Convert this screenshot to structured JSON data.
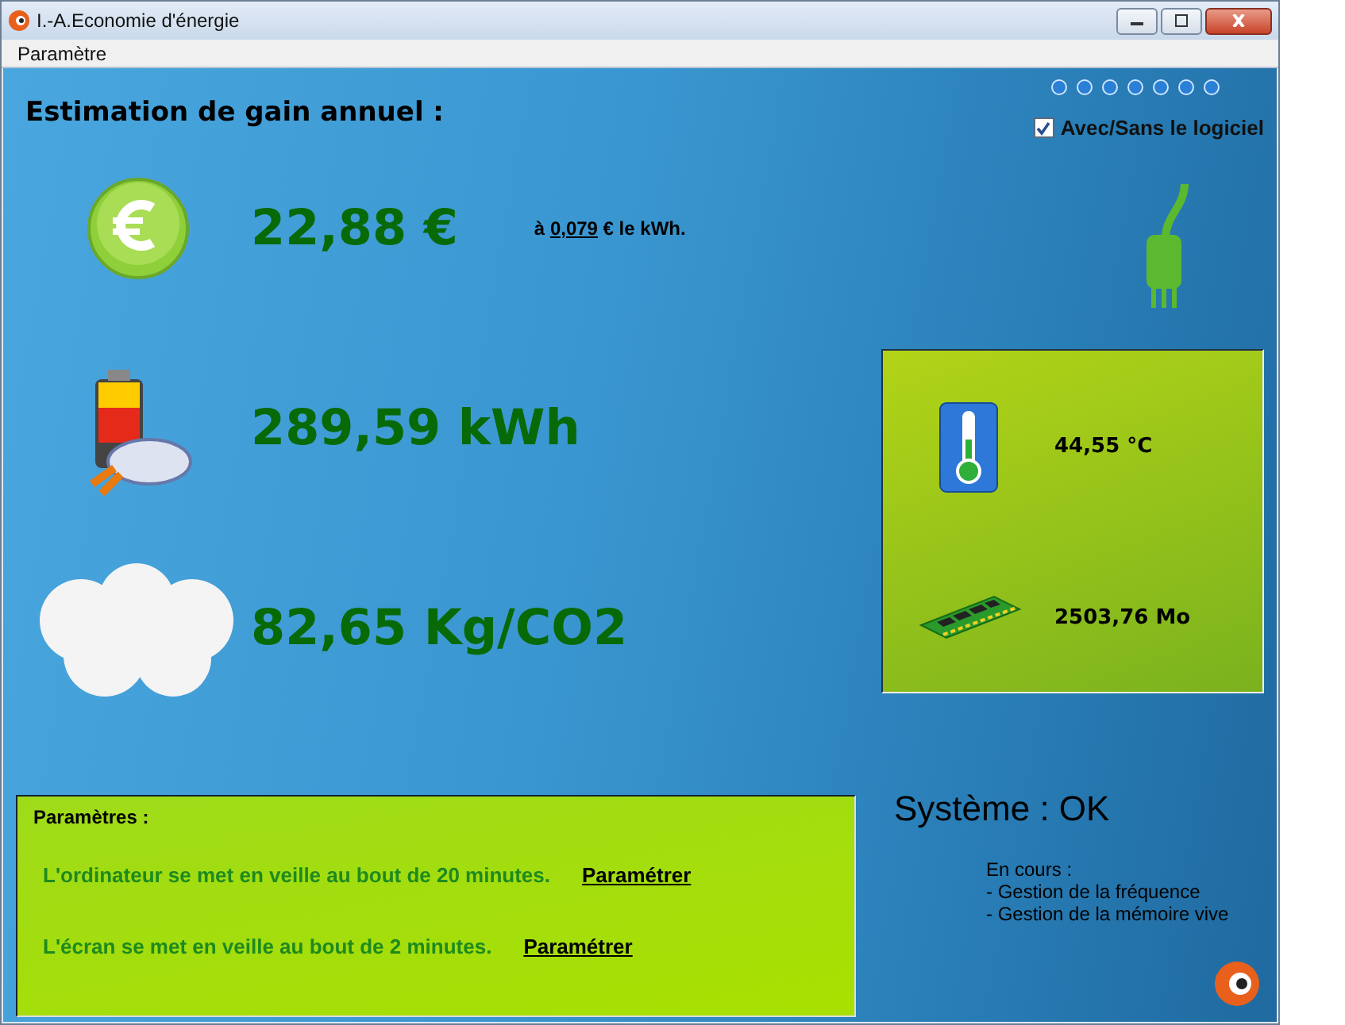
{
  "window": {
    "title": "I.-A.Economie d'énergie"
  },
  "menu": [
    "Paramètre"
  ],
  "header": {
    "title": "Estimation de gain annuel :",
    "toggle": {
      "label": "Avec/Sans le logiciel",
      "checked": true
    }
  },
  "stats": [
    {
      "kind": "money",
      "value": "22,88 €"
    },
    {
      "kind": "energy",
      "value": "289,59 kWh"
    },
    {
      "kind": "co2",
      "value": "82,65 Kg/CO2"
    }
  ],
  "rate": {
    "prefix": "à",
    "link": "0,079",
    "suffix": "€  le kWh."
  },
  "sensors": [
    {
      "kind": "temperature",
      "value": "44,55 °C"
    },
    {
      "kind": "memory",
      "value": "2503,76 Mo"
    }
  ],
  "settings": {
    "title": "Paramètres :",
    "rows": [
      {
        "text": "L'ordinateur se met en veille au bout de 20 minutes.",
        "link": "Paramétrer"
      },
      {
        "text": "L'écran se met en veille au bout de 2 minutes.",
        "link": "Paramétrer"
      }
    ]
  },
  "status": {
    "title": "Système : OK",
    "lines": [
      "En cours :",
      "- Gestion de la fréquence",
      "- Gestion de la mémoire vive"
    ]
  }
}
